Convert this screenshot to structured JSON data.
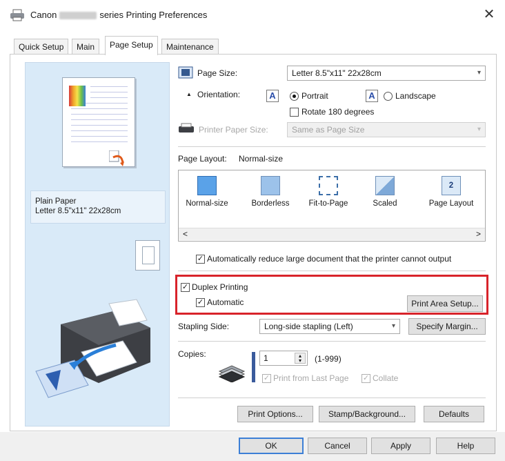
{
  "window": {
    "title_prefix": "Canon",
    "title_suffix": "series Printing Preferences",
    "close_glyph": "✕"
  },
  "tabs": [
    {
      "label": "Quick Setup",
      "active": false
    },
    {
      "label": "Main",
      "active": false
    },
    {
      "label": "Page Setup",
      "active": true
    },
    {
      "label": "Maintenance",
      "active": false
    }
  ],
  "preview": {
    "media_type": "Plain Paper",
    "media_size": "Letter 8.5\"x11\" 22x28cm"
  },
  "page_size": {
    "label": "Page Size:",
    "value": "Letter 8.5\"x11\" 22x28cm"
  },
  "orientation": {
    "label": "Orientation:",
    "icon_glyph": "A",
    "portrait": "Portrait",
    "landscape": "Landscape",
    "selected": "Portrait",
    "rotate_label": "Rotate 180 degrees",
    "rotate_checked": false
  },
  "printer_paper_size": {
    "label": "Printer Paper Size:",
    "value": "Same as Page Size",
    "enabled": false
  },
  "page_layout": {
    "label": "Page Layout:",
    "current": "Normal-size",
    "items": [
      {
        "label": "Normal-size",
        "icon": "normal-size-icon"
      },
      {
        "label": "Borderless",
        "icon": "borderless-icon"
      },
      {
        "label": "Fit-to-Page",
        "icon": "fit-to-page-icon"
      },
      {
        "label": "Scaled",
        "icon": "scaled-icon"
      },
      {
        "label": "Page Layout",
        "icon": "page-layout-icon",
        "glyph": "2"
      }
    ],
    "scroll_left": "<",
    "scroll_right": ">"
  },
  "auto_reduce": {
    "label": "Automatically reduce large document that the printer cannot output",
    "checked": true
  },
  "duplex": {
    "label": "Duplex Printing",
    "checked": true,
    "automatic_label": "Automatic",
    "automatic_checked": true,
    "print_area_button": "Print Area Setup..."
  },
  "stapling": {
    "label": "Stapling Side:",
    "value": "Long-side stapling (Left)",
    "margin_button": "Specify Margin..."
  },
  "copies": {
    "label": "Copies:",
    "value": "1",
    "range": "(1-999)",
    "print_from_last": "Print from Last Page",
    "collate": "Collate"
  },
  "lower_buttons": {
    "print_options": "Print Options...",
    "stamp_background": "Stamp/Background...",
    "defaults": "Defaults"
  },
  "dialog_buttons": {
    "ok": "OK",
    "cancel": "Cancel",
    "apply": "Apply",
    "help": "Help"
  },
  "colors": {
    "highlight": "#d8232a",
    "preview_bg": "#d9eaf8",
    "focus_border": "#3c7fd6"
  }
}
